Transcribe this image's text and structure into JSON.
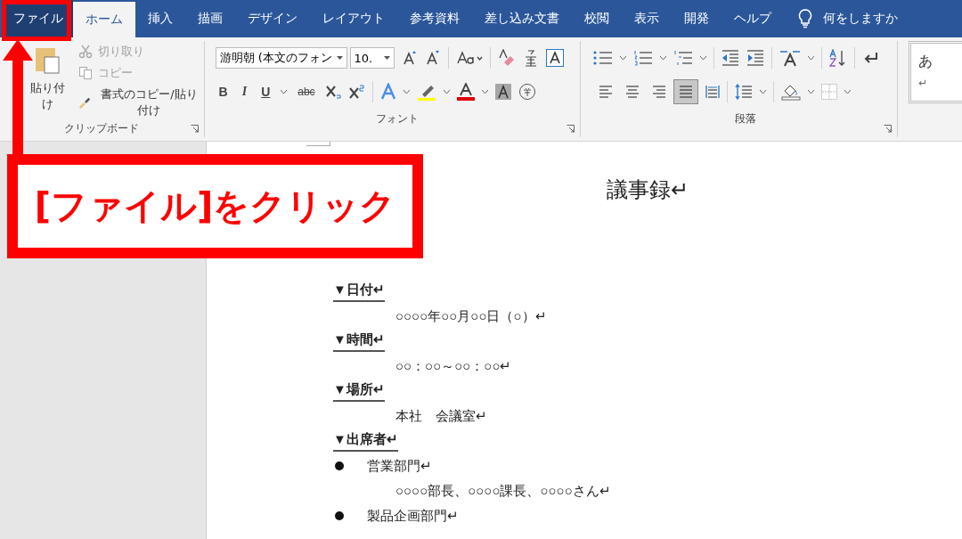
{
  "tabs": [
    {
      "label": "ファイル",
      "kind": "file",
      "selected": false
    },
    {
      "label": "ホーム",
      "kind": "tab",
      "selected": true
    },
    {
      "label": "挿入",
      "kind": "tab",
      "selected": false
    },
    {
      "label": "描画",
      "kind": "tab",
      "selected": false
    },
    {
      "label": "デザイン",
      "kind": "tab",
      "selected": false
    },
    {
      "label": "レイアウト",
      "kind": "tab",
      "selected": false
    },
    {
      "label": "参考資料",
      "kind": "tab",
      "selected": false
    },
    {
      "label": "差し込み文書",
      "kind": "tab",
      "selected": false
    },
    {
      "label": "校閲",
      "kind": "tab",
      "selected": false
    },
    {
      "label": "表示",
      "kind": "tab",
      "selected": false
    },
    {
      "label": "開発",
      "kind": "tab",
      "selected": false
    },
    {
      "label": "ヘルプ",
      "kind": "tab",
      "selected": false
    }
  ],
  "tell_me": {
    "text": "何をしますか"
  },
  "clipboard": {
    "paste_label": "貼り付け",
    "group_label": "クリップボード",
    "items": [
      {
        "kind": "cut",
        "label": "切り取り",
        "disabled": true
      },
      {
        "kind": "copy",
        "label": "コピー",
        "disabled": true
      },
      {
        "kind": "painter",
        "label": "書式のコピー/貼り付け",
        "disabled": false
      }
    ]
  },
  "font": {
    "font_name": "游明朝 (本文のフォン",
    "font_size": "10.",
    "group_label": "フォント",
    "format_buttons": [
      "B",
      "I",
      "U",
      "abc"
    ]
  },
  "paragraph": {
    "group_label": "段落",
    "alignments": [
      {
        "kind": "left",
        "selected": false
      },
      {
        "kind": "center",
        "selected": false
      },
      {
        "kind": "right",
        "selected": false
      },
      {
        "kind": "justify",
        "selected": true
      },
      {
        "kind": "distributed",
        "selected": false
      }
    ]
  },
  "styles": {
    "preview": "あ",
    "mark": "↵"
  },
  "callout": {
    "text": "[ファイル]をクリック"
  },
  "document": {
    "title": "議事録↵",
    "sections": [
      {
        "heading": "▼日付↵",
        "lines": [
          {
            "kind": "text",
            "text": "○○○○年○○月○○日（○）↵"
          }
        ]
      },
      {
        "heading": "▼時間↵",
        "lines": [
          {
            "kind": "text",
            "text": "○○：○○～○○：○○↵"
          }
        ]
      },
      {
        "heading": "▼場所↵",
        "lines": [
          {
            "kind": "text",
            "text": "本社　会議室↵"
          }
        ]
      },
      {
        "heading": "▼出席者↵",
        "lines": [
          {
            "kind": "bullet",
            "text": "営業部門↵"
          },
          {
            "kind": "text",
            "text": "○○○○部長、○○○○課長、○○○○さん↵"
          },
          {
            "kind": "bullet",
            "text": "製品企画部門↵"
          }
        ]
      }
    ]
  }
}
